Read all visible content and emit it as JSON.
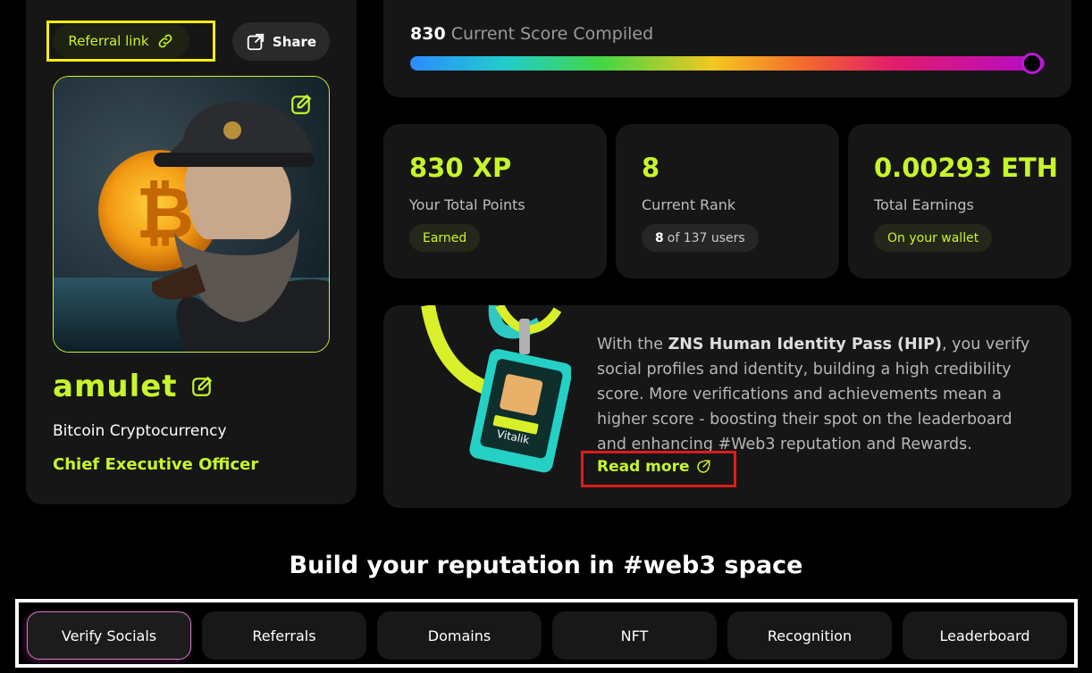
{
  "profile": {
    "referral_label": "Referral link",
    "share_label": "Share",
    "username": "amulet",
    "organization": "Bitcoin Cryptocurrency",
    "role": "Chief Executive Officer"
  },
  "score": {
    "value": "830",
    "label": "Current Score Compiled",
    "progress": 0.98
  },
  "stats": [
    {
      "value": "830 XP",
      "label": "Your Total Points",
      "pill": "Earned"
    },
    {
      "value": "8",
      "label": "Current Rank",
      "pill_rank": "8",
      "pill_rest": "of 137 users"
    },
    {
      "value": "0.00293 ETH",
      "label": "Total Earnings",
      "pill": "On your wallet"
    }
  ],
  "hip": {
    "text_pre": "With the ",
    "text_bold": "ZNS Human Identity Pass (HIP)",
    "text_post": ", you verify social profiles and identity, building a high credibility score. More verifications and achievements mean a higher score - boosting their spot on the leaderboard and enhancing #Web3 reputation and Rewards.",
    "read_more": "Read more",
    "badge_name": "Vitalik"
  },
  "heading": "Build your reputation in #web3 space",
  "tabs": [
    "Verify Socials",
    "Referrals",
    "Domains",
    "NFT",
    "Recognition",
    "Leaderboard"
  ],
  "colors": {
    "accent": "#c7f52a",
    "background": "#000000",
    "card": "#161616"
  }
}
